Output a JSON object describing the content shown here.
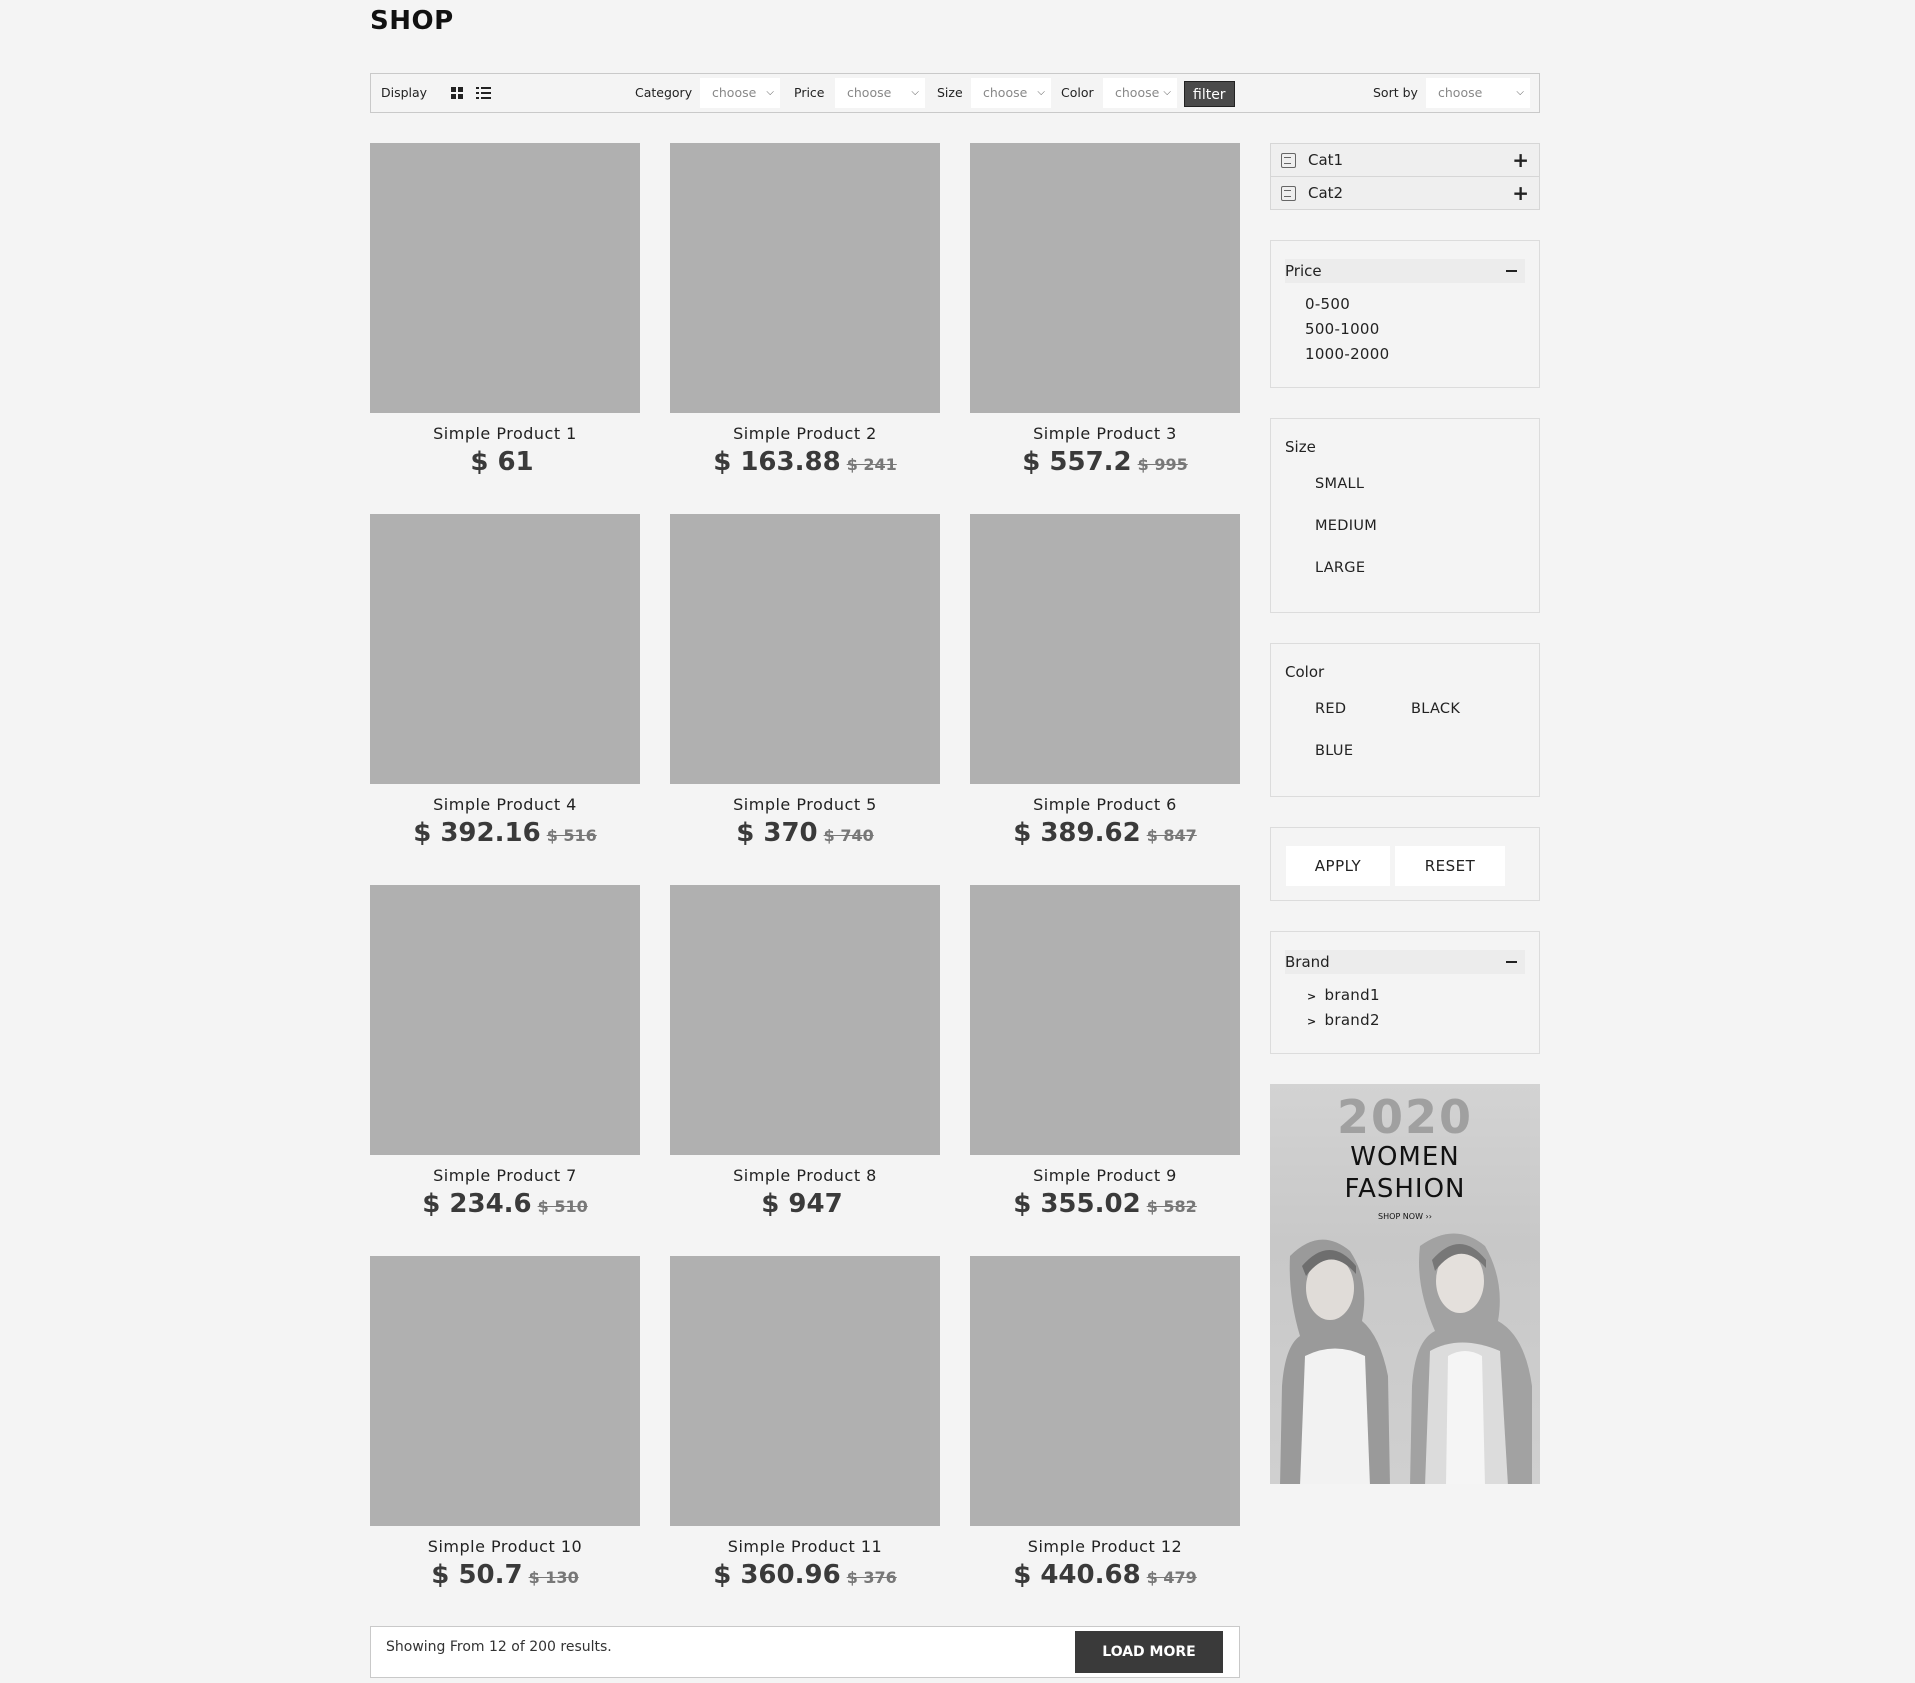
{
  "page": {
    "title": "SHOP"
  },
  "toolbar": {
    "display_label": "Display",
    "category_label": "Category",
    "category_value": "choose",
    "price_label": "Price",
    "price_value": "choose",
    "size_label": "Size",
    "size_value": "choose",
    "color_label": "Color",
    "color_value": "choose",
    "filter_label": "filter",
    "sortby_label": "Sort by",
    "sortby_value": "choose",
    "icons": [
      "grid-view-icon",
      "list-view-icon",
      "chevron-down-icon"
    ]
  },
  "products": [
    {
      "name": "Simple Product 1",
      "price": "$ 61",
      "old_price": ""
    },
    {
      "name": "Simple Product 2",
      "price": "$ 163.88",
      "old_price": "$ 241"
    },
    {
      "name": "Simple Product 3",
      "price": "$ 557.2",
      "old_price": "$ 995"
    },
    {
      "name": "Simple Product 4",
      "price": "$ 392.16",
      "old_price": "$ 516"
    },
    {
      "name": "Simple Product 5",
      "price": "$ 370",
      "old_price": "$ 740"
    },
    {
      "name": "Simple Product 6",
      "price": "$ 389.62",
      "old_price": "$ 847"
    },
    {
      "name": "Simple Product 7",
      "price": "$ 234.6",
      "old_price": "$ 510"
    },
    {
      "name": "Simple Product 8",
      "price": "$ 947",
      "old_price": ""
    },
    {
      "name": "Simple Product 9",
      "price": "$ 355.02",
      "old_price": "$ 582"
    },
    {
      "name": "Simple Product 10",
      "price": "$ 50.7",
      "old_price": "$ 130"
    },
    {
      "name": "Simple Product 11",
      "price": "$ 360.96",
      "old_price": "$ 376"
    },
    {
      "name": "Simple Product 12",
      "price": "$ 440.68",
      "old_price": "$ 479"
    }
  ],
  "sidebar": {
    "categories": [
      {
        "label": "Cat1"
      },
      {
        "label": "Cat2"
      }
    ],
    "price": {
      "title": "Price",
      "options": [
        "0-500",
        "500-1000",
        "1000-2000"
      ]
    },
    "size": {
      "title": "Size",
      "options": [
        "SMALL",
        "MEDIUM",
        "LARGE"
      ]
    },
    "color": {
      "title": "Color",
      "options": [
        "RED",
        "BLACK",
        "BLUE"
      ]
    },
    "actions": {
      "apply": "APPLY",
      "reset": "RESET"
    },
    "brand": {
      "title": "Brand",
      "items": [
        "brand1",
        "brand2"
      ]
    }
  },
  "banner": {
    "year": "2020",
    "line1": "WOMEN",
    "line2": "FASHION",
    "cta": "SHOP NOW ››"
  },
  "footer": {
    "results_text": "Showing From 12 of 200 results.",
    "load_more": "LOAD MORE"
  }
}
